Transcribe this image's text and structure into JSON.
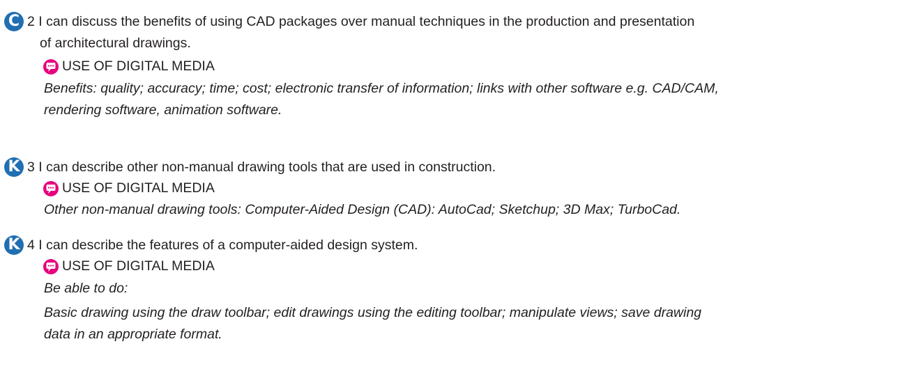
{
  "colors": {
    "badge_blue": "#1f6fb2",
    "media_pink": "#e6007e",
    "text": "#231f20"
  },
  "items": [
    {
      "badge": "C",
      "lines": [
        "2 I can discuss the benefits of using CAD packages over manual techniques in the production and presentation",
        "of architectural drawings."
      ],
      "media_label": "USE OF DIGITAL MEDIA",
      "notes": [
        "Benefits: quality; accuracy; time; cost; electronic transfer of information; links with other software e.g. CAD/CAM,",
        "rendering software, animation software."
      ]
    },
    {
      "badge": "K",
      "lines": [
        "3 I can describe other non-manual drawing tools that are used in construction."
      ],
      "media_label": "USE OF DIGITAL MEDIA",
      "notes": [
        "Other non-manual drawing tools: Computer-Aided Design (CAD): AutoCad; Sketchup; 3D Max; TurboCad."
      ]
    },
    {
      "badge": "K",
      "lines": [
        "4 I can describe the features of a computer-aided design system."
      ],
      "media_label": "USE OF DIGITAL MEDIA",
      "notes": [
        "Be able to do:",
        "Basic drawing using the draw toolbar; edit drawings using the editing toolbar; manipulate views; save drawing",
        "data in an appropriate format."
      ]
    }
  ]
}
